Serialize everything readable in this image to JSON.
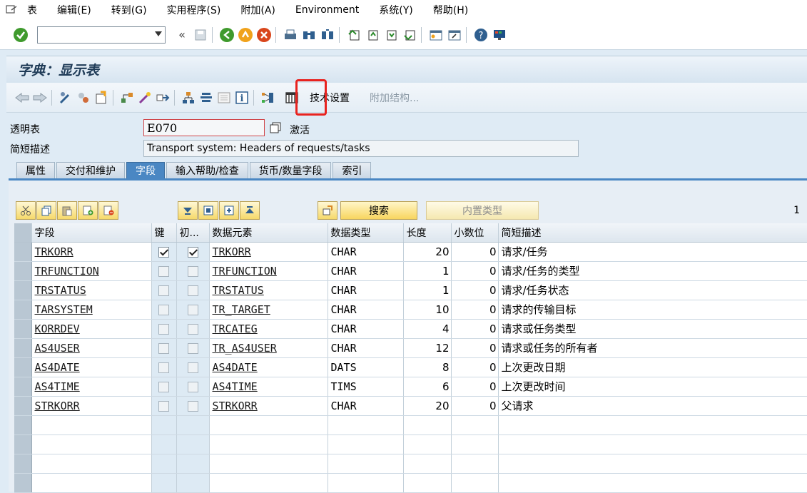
{
  "menu": [
    "表",
    "编辑(E)",
    "转到(G)",
    "实用程序(S)",
    "附加(A)",
    "Environment",
    "系统(Y)",
    "帮助(H)"
  ],
  "title": "字典：显示表",
  "appbar": {
    "tech_settings": "技术设置",
    "append_structure": "附加结构..."
  },
  "form": {
    "table_label": "透明表",
    "table_value": "E070",
    "status": "激活",
    "desc_label": "简短描述",
    "desc_value": "Transport system: Headers of requests/tasks"
  },
  "tabs": [
    "属性",
    "交付和维护",
    "字段",
    "输入帮助/检查",
    "货币/数量字段",
    "索引"
  ],
  "active_tab": 2,
  "panel": {
    "search_button": "搜索",
    "builtin_type_button": "内置类型",
    "page": "1"
  },
  "columns": [
    "字段",
    "键",
    "初...",
    "数据元素",
    "数据类型",
    "长度",
    "小数位",
    "简短描述"
  ],
  "rows": [
    {
      "field": "TRKORR",
      "key": true,
      "init": true,
      "element": "TRKORR",
      "type": "CHAR",
      "length": "20",
      "decimals": "0",
      "desc": "请求/任务"
    },
    {
      "field": "TRFUNCTION",
      "key": false,
      "init": false,
      "element": "TRFUNCTION",
      "type": "CHAR",
      "length": "1",
      "decimals": "0",
      "desc": "请求/任务的类型"
    },
    {
      "field": "TRSTATUS",
      "key": false,
      "init": false,
      "element": "TRSTATUS",
      "type": "CHAR",
      "length": "1",
      "decimals": "0",
      "desc": "请求/任务状态"
    },
    {
      "field": "TARSYSTEM",
      "key": false,
      "init": false,
      "element": "TR_TARGET",
      "type": "CHAR",
      "length": "10",
      "decimals": "0",
      "desc": "请求的传输目标"
    },
    {
      "field": "KORRDEV",
      "key": false,
      "init": false,
      "element": "TRCATEG",
      "type": "CHAR",
      "length": "4",
      "decimals": "0",
      "desc": "请求或任务类型"
    },
    {
      "field": "AS4USER",
      "key": false,
      "init": false,
      "element": "TR_AS4USER",
      "type": "CHAR",
      "length": "12",
      "decimals": "0",
      "desc": "请求或任务的所有者"
    },
    {
      "field": "AS4DATE",
      "key": false,
      "init": false,
      "element": "AS4DATE",
      "type": "DATS",
      "length": "8",
      "decimals": "0",
      "desc": "上次更改日期"
    },
    {
      "field": "AS4TIME",
      "key": false,
      "init": false,
      "element": "AS4TIME",
      "type": "TIMS",
      "length": "6",
      "decimals": "0",
      "desc": "上次更改时间"
    },
    {
      "field": "STRKORR",
      "key": false,
      "init": false,
      "element": "STRKORR",
      "type": "CHAR",
      "length": "20",
      "decimals": "0",
      "desc": "父请求"
    }
  ]
}
